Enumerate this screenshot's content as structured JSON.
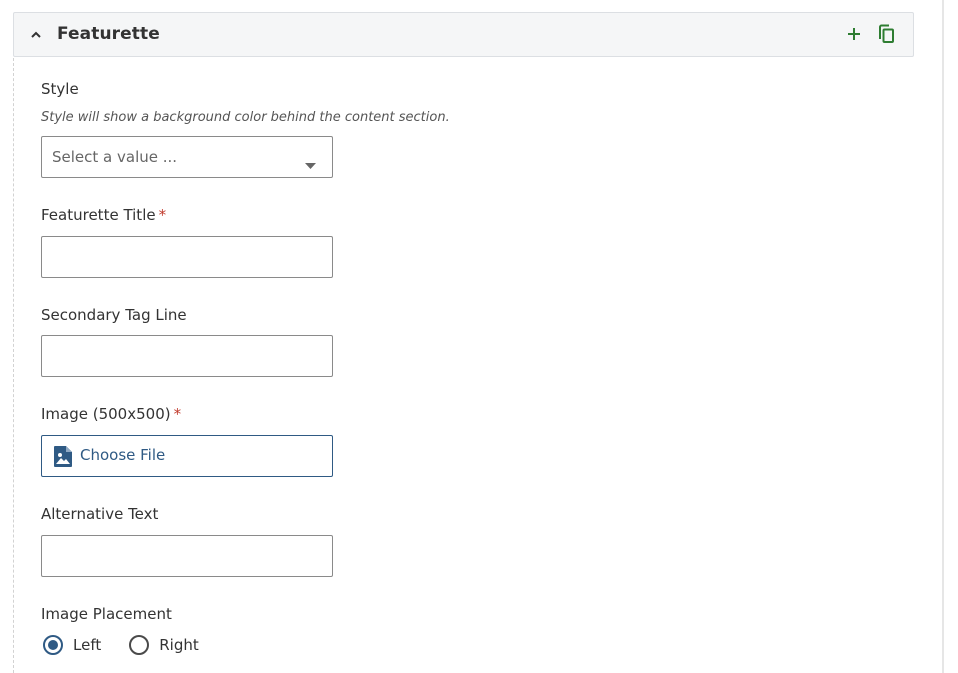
{
  "panel": {
    "title": "Featurette",
    "add_icon": "plus-icon",
    "duplicate_icon": "copy-icon",
    "collapse_icon": "chevron-up-icon",
    "accent_color": "#2e7d32"
  },
  "style_field": {
    "label": "Style",
    "help": "Style will show a background color behind the content section.",
    "placeholder": "Select a value ..."
  },
  "title_field": {
    "label": "Featurette Title",
    "required_mark": "*",
    "value": ""
  },
  "tagline_field": {
    "label": "Secondary Tag Line",
    "value": ""
  },
  "image_field": {
    "label": "Image (500x500)",
    "required_mark": "*",
    "button_label": "Choose File",
    "icon": "image-file-icon"
  },
  "alt_field": {
    "label": "Alternative Text",
    "value": ""
  },
  "placement_field": {
    "label": "Image Placement",
    "options": [
      "Left",
      "Right"
    ],
    "selected": "Left"
  },
  "colors": {
    "primary_blue": "#2f5a84",
    "required_red": "#c0392b",
    "header_bg": "#f5f6f7"
  }
}
